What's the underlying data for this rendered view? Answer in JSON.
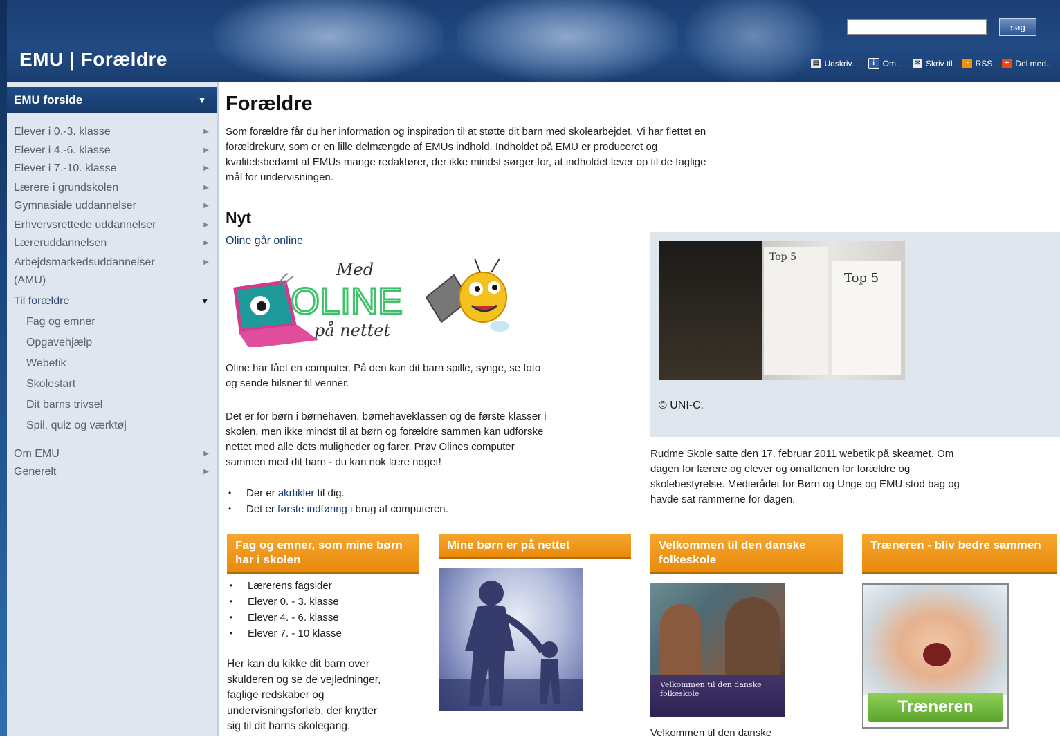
{
  "header": {
    "site_title": "EMU | Forældre",
    "search": {
      "value": "",
      "placeholder": "",
      "button_label": "søg"
    },
    "toolbar": [
      {
        "icon": "printer-icon",
        "label": "Udskriv..."
      },
      {
        "icon": "info-icon",
        "label": "Om..."
      },
      {
        "icon": "envelope-icon",
        "label": "Skriv til"
      },
      {
        "icon": "rss-icon",
        "label": "RSS"
      },
      {
        "icon": "share-icon",
        "label": "Del med..."
      }
    ]
  },
  "sidebar": {
    "head": "EMU forside",
    "items": [
      "Elever i 0.-3. klasse",
      "Elever i 4.-6. klasse",
      "Elever i 7.-10. klasse",
      "Lærere i grundskolen",
      "Gymnasiale uddannelser",
      "Erhvervsrettede uddannelser",
      "Læreruddannelsen",
      "Arbejdsmarkedsuddannelser",
      "(AMU)"
    ],
    "active": "Til forældre",
    "subitems": [
      "Fag og emner",
      "Opgavehjælp",
      "Webetik",
      "Skolestart",
      "Dit barns trivsel",
      "Spil, quiz og værktøj"
    ],
    "bottom": [
      "Om EMU",
      "Generelt"
    ]
  },
  "main": {
    "title": "Forældre",
    "intro_lines": [
      "Som forældre får du her information og inspiration til at støtte dit barn med skolearbejdet. Vi har flettet en",
      "forældrekurv, som er en lille delmængde af EMUs indhold. Indholdet på EMU er produceret og",
      "kvalitetsbedømt af EMUs mange redaktører, der ikke mindst sørger for, at indholdet lever op til de faglige",
      "mål for undervisningen."
    ],
    "nyt_heading": "Nyt",
    "news_link": "Oline går online",
    "logo": {
      "top": "Med",
      "main": "OLINE",
      "bottom": "på nettet"
    },
    "para1_lines": [
      "Oline har fået en computer. På den kan dit barn spille, synge, se foto",
      "og sende hilsner til venner."
    ],
    "para2_lines": [
      "Det er for børn i børnehaven, børnehaveklassen og de første klasser i",
      "skolen, men ikke mindst til at børn og forældre sammen kan udforske",
      "nettet med alle dets muligheder og farer. Prøv Olines computer",
      "sammen med dit barn - du kan nok lære noget!"
    ],
    "bullets": [
      {
        "pre": "Der er ",
        "link": "akrtikler",
        "post": " til dig."
      },
      {
        "pre": "Det er ",
        "link": "første indføring",
        "post": " i brug af computeren."
      }
    ],
    "photo_credit": "© UNI-C.",
    "photo_sign1": "Top 5",
    "photo_sign2": "Top 5",
    "right_para_lines": [
      "Rudme Skole satte den 17. februar 2011 webetik på skeamet. Om",
      "dagen for lærere og elever og omaftenen for forældre og",
      "skolebestyrelse. Medierådet for Børn og Unge og EMU stod bag og",
      "havde sat rammerne for dagen."
    ],
    "boxes": [
      {
        "title": "Fag og emner, som mine børn har i skolen"
      },
      {
        "title": "Mine børn er på nettet"
      },
      {
        "title": "Velkommen til den danske folkeskole"
      },
      {
        "title": "Træneren - bliv bedre sammen"
      }
    ],
    "box1_list": [
      "Lærerens fagsider",
      "Elever 0. - 3. klasse",
      "Elever 4. - 6. klasse",
      "Elever 7. - 10 klasse"
    ],
    "box1_para_lines": [
      "Her kan du kikke dit barn over",
      "skulderen og se de vejledninger,",
      "faglige redskaber og",
      "undervisningsforløb, der knytter",
      "sig til dit barns skolegang."
    ],
    "box3_image_text": "Velkommen til den danske folkeskole",
    "box3_caption": "Velkommen til den danske",
    "box4_image_label": "Træneren"
  }
}
